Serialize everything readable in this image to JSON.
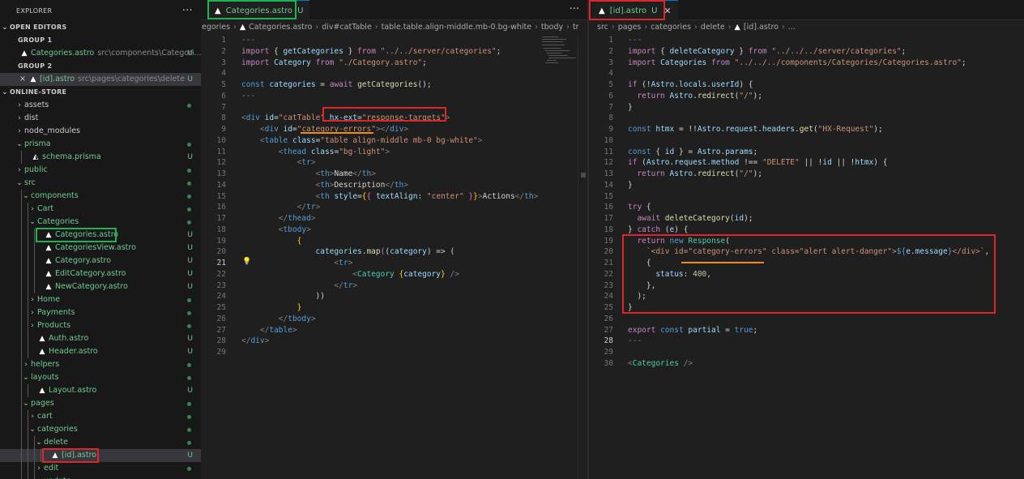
{
  "explorer": {
    "title": "EXPLORER",
    "more": "···",
    "open_editors": "OPEN EDITORS",
    "group1": "GROUP 1",
    "group1_file": "Categories.astro",
    "group1_path": "src\\components\\Categori...",
    "group1_status": "U",
    "group2": "GROUP 2",
    "group2_close": "×",
    "group2_file": "[id].astro",
    "group2_path": "src\\pages\\categories\\delete",
    "group2_status": "U",
    "project": "ONLINE-STORE",
    "tree": [
      {
        "label": "assets",
        "depth": 1,
        "kind": "folder-closed",
        "mark": "dot"
      },
      {
        "label": "dist",
        "depth": 1,
        "kind": "folder-closed",
        "mark": ""
      },
      {
        "label": "node_modules",
        "depth": 1,
        "kind": "folder-closed",
        "mark": ""
      },
      {
        "label": "prisma",
        "depth": 1,
        "kind": "folder-open",
        "mark": "dot",
        "green": true
      },
      {
        "label": "schema.prisma",
        "depth": 2,
        "kind": "file",
        "mark": "U",
        "green": true
      },
      {
        "label": "public",
        "depth": 1,
        "kind": "folder-closed",
        "mark": "dot",
        "green": true
      },
      {
        "label": "src",
        "depth": 1,
        "kind": "folder-open",
        "mark": "dot",
        "green": true
      },
      {
        "label": "components",
        "depth": 2,
        "kind": "folder-open",
        "mark": "dot",
        "green": true
      },
      {
        "label": "Cart",
        "depth": 3,
        "kind": "folder-closed",
        "mark": "dot",
        "green": true
      },
      {
        "label": "Categories",
        "depth": 3,
        "kind": "folder-open",
        "mark": "dot",
        "green": true
      },
      {
        "label": "Categories.astro",
        "depth": 4,
        "kind": "file",
        "mark": "U",
        "green": true,
        "boxed": "green"
      },
      {
        "label": "CategoriesView.astro",
        "depth": 4,
        "kind": "file",
        "mark": "U",
        "green": true
      },
      {
        "label": "Category.astro",
        "depth": 4,
        "kind": "file",
        "mark": "U",
        "green": true
      },
      {
        "label": "EditCategory.astro",
        "depth": 4,
        "kind": "file",
        "mark": "U",
        "green": true
      },
      {
        "label": "NewCategory.astro",
        "depth": 4,
        "kind": "file",
        "mark": "U",
        "green": true
      },
      {
        "label": "Home",
        "depth": 3,
        "kind": "folder-closed",
        "mark": "dot",
        "green": true
      },
      {
        "label": "Payments",
        "depth": 3,
        "kind": "folder-closed",
        "mark": "dot",
        "green": true
      },
      {
        "label": "Products",
        "depth": 3,
        "kind": "folder-closed",
        "mark": "dot",
        "green": true
      },
      {
        "label": "Auth.astro",
        "depth": 3,
        "kind": "file",
        "mark": "U",
        "green": true
      },
      {
        "label": "Header.astro",
        "depth": 3,
        "kind": "file",
        "mark": "U",
        "green": true
      },
      {
        "label": "helpers",
        "depth": 2,
        "kind": "folder-closed",
        "mark": "dot",
        "green": true
      },
      {
        "label": "layouts",
        "depth": 2,
        "kind": "folder-open",
        "mark": "dot",
        "green": true
      },
      {
        "label": "Layout.astro",
        "depth": 3,
        "kind": "file",
        "mark": "U",
        "green": true
      },
      {
        "label": "pages",
        "depth": 2,
        "kind": "folder-open",
        "mark": "dot",
        "green": true
      },
      {
        "label": "cart",
        "depth": 3,
        "kind": "folder-closed",
        "mark": "dot",
        "green": true
      },
      {
        "label": "categories",
        "depth": 3,
        "kind": "folder-open",
        "mark": "dot",
        "green": true
      },
      {
        "label": "delete",
        "depth": 4,
        "kind": "folder-open",
        "mark": "dot",
        "green": true
      },
      {
        "label": "[id].astro",
        "depth": 5,
        "kind": "file",
        "mark": "U",
        "green": true,
        "boxed": "red",
        "selected": true
      },
      {
        "label": "edit",
        "depth": 4,
        "kind": "folder-closed",
        "mark": "dot",
        "green": true
      },
      {
        "label": "update",
        "depth": 4,
        "kind": "folder-open",
        "mark": "dot",
        "green": true
      }
    ]
  },
  "left_editor": {
    "tab_label": "Categories.astro",
    "tab_status": "U",
    "more": "···",
    "breadcrumbs": [
      "egories",
      "Categories.astro",
      "div#catTable",
      "table.table.align-middle.mb-0.bg-white",
      "tbody",
      "tr"
    ],
    "current_line": "21"
  },
  "right_editor": {
    "tab_label": "[id].astro",
    "tab_status": "U",
    "tab_close": "✕",
    "breadcrumbs": [
      "src",
      "pages",
      "categories",
      "delete",
      "[id].astro",
      "..."
    ],
    "current_line": "28"
  },
  "colors": {
    "highlight_red": "#e0242b",
    "highlight_green": "#1db254",
    "underline_orange": "#f08c1e",
    "untracked_green": "#73c991"
  }
}
